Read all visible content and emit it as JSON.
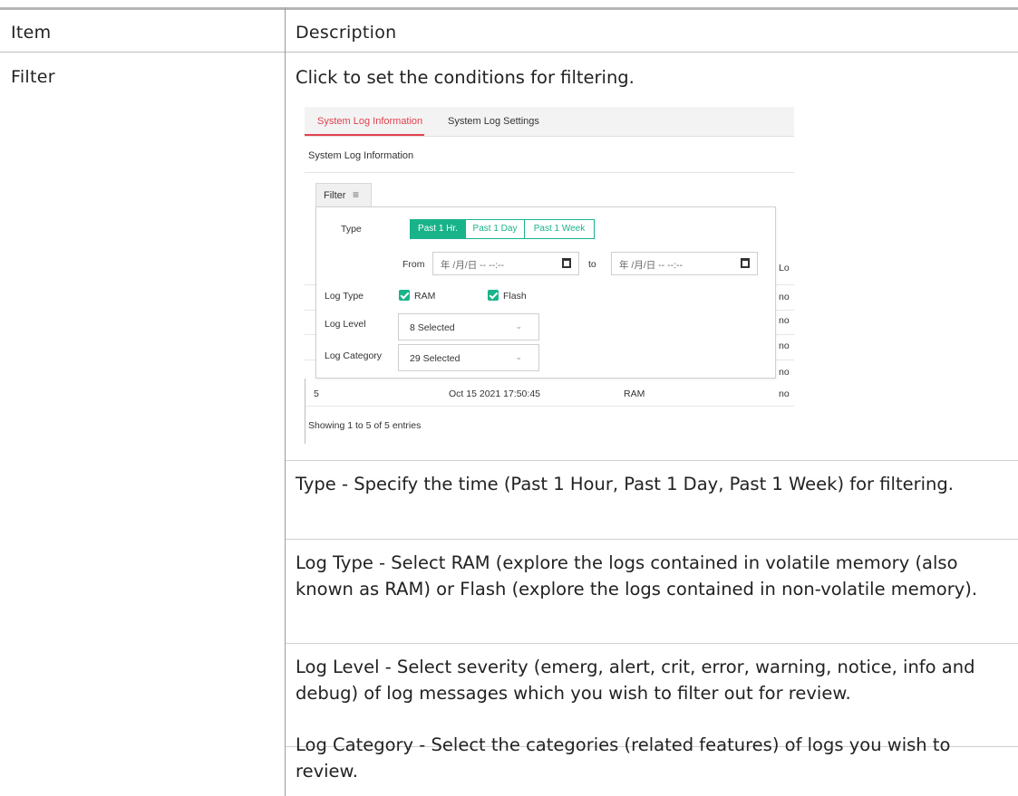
{
  "table": {
    "headers": {
      "item": "Item",
      "description": "Description"
    },
    "row": {
      "item": "Filter",
      "intro": "Click to set the conditions for filtering.",
      "paragraphs": [
        "Type - Specify the time (Past 1 Hour, Past 1 Day, Past 1 Week) for filtering.",
        "Log Type - Select RAM (explore the logs contained in volatile memory (also known as RAM) or Flash (explore the logs contained in non-volatile memory).",
        "Log Level - Select severity (emerg, alert, crit, error, warning, notice, info and debug) of log messages which you wish to filter out for review.",
        "Log Category - Select the categories (related features) of logs you wish to review."
      ]
    }
  },
  "screenshot": {
    "tabs": [
      "System Log Information",
      "System Log Settings"
    ],
    "active_tab": "System Log Information",
    "panel_title": "System Log Information",
    "filter_button": "Filter",
    "filter_icon": "sliders-icon",
    "type_label": "Type",
    "type_options": [
      "Past 1 Hr.",
      "Past 1 Day",
      "Past 1 Week"
    ],
    "type_selected": "Past 1 Hr.",
    "from_label": "From",
    "from_value": "年 /月/日 -- --:--",
    "to_label": "to",
    "to_value": "年 /月/日 -- --:--",
    "log_type_label": "Log Type",
    "log_type_options": [
      {
        "label": "RAM",
        "checked": true
      },
      {
        "label": "Flash",
        "checked": true
      }
    ],
    "log_level_label": "Log Level",
    "log_level_value": "8 Selected",
    "log_category_label": "Log Category",
    "log_category_value": "29 Selected",
    "bg_column_header": "Lo",
    "bg_cells": [
      "no",
      "no",
      "no",
      "no"
    ],
    "last_row": {
      "index": "5",
      "time": "Oct 15 2021 17:50:45",
      "type": "RAM",
      "extra": "no"
    },
    "footer": "Showing 1 to 5 of 5 entries",
    "accent_color": "#19b38a",
    "tab_active_color": "#e0424f"
  }
}
